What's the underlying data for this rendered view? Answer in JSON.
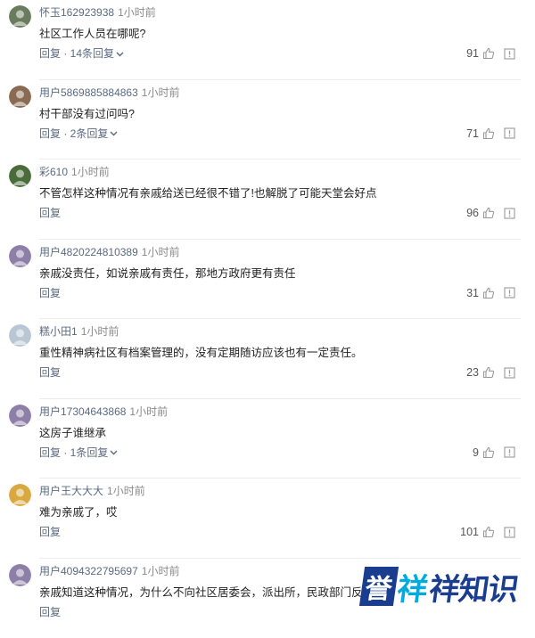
{
  "comments": [
    {
      "user": "怀玉162923938",
      "time": "1小时前",
      "text": "社区工作人员在哪呢?",
      "reply": "回复 · 14条回复",
      "likes": "91",
      "expand": true,
      "avatar_color": "#6b7c5e"
    },
    {
      "user": "用户5869885884863",
      "time": "1小时前",
      "text": "村干部没有过问吗?",
      "reply": "回复 · 2条回复",
      "likes": "71",
      "expand": true,
      "avatar_color": "#8a6a52"
    },
    {
      "user": "彩610",
      "time": "1小时前",
      "text": "不管怎样这种情况有亲戚给送已经很不错了!也解脱了可能天堂会好点",
      "reply": "回复",
      "likes": "96",
      "expand": false,
      "avatar_color": "#4a6b3a"
    },
    {
      "user": "用户4820224810389",
      "time": "1小时前",
      "text": "亲戚没责任，如说亲戚有责任，那地方政府更有责任",
      "reply": "回复",
      "likes": "31",
      "expand": false,
      "avatar_color": "#8e7fa8"
    },
    {
      "user": "糕小田1",
      "time": "1小时前",
      "text": "重性精神病社区有档案管理的，没有定期随访应该也有一定责任。",
      "reply": "回复",
      "likes": "23",
      "expand": false,
      "avatar_color": "#b9c6d4"
    },
    {
      "user": "用户17304643868",
      "time": "1小时前",
      "text": "这房子谁继承",
      "reply": "回复 · 1条回复",
      "likes": "9",
      "expand": true,
      "avatar_color": "#8e7fa8"
    },
    {
      "user": "用户王大大大",
      "time": "1小时前",
      "text": "难为亲戚了，哎",
      "reply": "回复",
      "likes": "101",
      "expand": false,
      "avatar_color": "#d9a840"
    },
    {
      "user": "用户4094322795697",
      "time": "1小时前",
      "text": "亲戚知道这种情况，为什么不向社区居委会，派出所，民政部门反",
      "reply": "回复",
      "likes": "",
      "expand": false,
      "avatar_color": "#8e7fa8"
    }
  ],
  "watermark": {
    "logo": "誉",
    "text1": "祥",
    "text2": "祥知识"
  }
}
